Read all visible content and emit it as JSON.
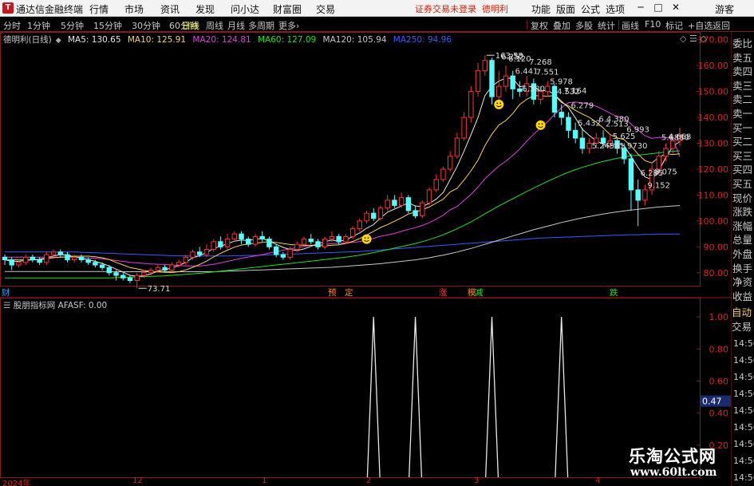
{
  "menubar": {
    "app_logo": "T",
    "app_title": "通达信金融终端",
    "items": [
      "行情",
      "市场",
      "资讯",
      "发现",
      "问小达",
      "财富圈",
      "交易"
    ],
    "trade_status": "证券交易未登录",
    "stock_name": "德明利",
    "right_items": [
      "功能",
      "版面",
      "公式",
      "选项"
    ],
    "user": "游客",
    "window_buttons": [
      "─",
      "□",
      "✕"
    ]
  },
  "periodbar": {
    "periods": [
      "分时",
      "1分钟",
      "5分钟",
      "15分钟",
      "30分钟",
      "60分钟",
      "日线",
      "周线",
      "月线",
      "多周期",
      "更多"
    ],
    "active_period": "日线",
    "more_arrow": "›",
    "tools": [
      "复权",
      "叠加",
      "多股",
      "统计",
      "画线",
      "F10",
      "标记",
      "+自选",
      "返回"
    ]
  },
  "chart_legend": {
    "title": "德明利(日线)",
    "collapse_icon": "◆",
    "ma": [
      {
        "label": "MA5: 130.65",
        "color": "#e8e8e8"
      },
      {
        "label": "MA10: 125.91",
        "color": "#ffd24a"
      },
      {
        "label": "MA20: 124.81",
        "color": "#e040e0"
      },
      {
        "label": "MA60: 127.09",
        "color": "#20e020"
      },
      {
        "label": "MA120: 105.94",
        "color": "#c8c8c8"
      },
      {
        "label": "MA250: 94.96",
        "color": "#3a5cff"
      }
    ],
    "controls": [
      "◇",
      "☰",
      "◇"
    ]
  },
  "price_axis": [
    "170.00",
    "160.00",
    "150.00",
    "140.00",
    "130.00",
    "120.00",
    "110.00",
    "100.00",
    "90.00",
    "80.00"
  ],
  "annotations": {
    "high": "163.58",
    "low": "73.71",
    "peak_labels": [
      "6.252",
      "6.120",
      "6.441",
      "6.380",
      "7.268",
      "7.551",
      "5.978",
      "4.532",
      "7.164",
      "6.279",
      "5.432",
      "5.2454",
      "6.4.380",
      "2.513",
      "5.625",
      "1.9730",
      "6.993",
      "6.285",
      "9.152",
      "8.075",
      "5.6880",
      "4.668"
    ]
  },
  "signals": [
    {
      "text": "财",
      "color": "#3aa0ff"
    },
    {
      "text": "预",
      "color": "#ff8c00"
    },
    {
      "text": "定",
      "color": "#ff8c00"
    },
    {
      "text": "涨",
      "color": "#ff3030"
    },
    {
      "text": "模",
      "color": "#ff8c00"
    },
    {
      "text": "减",
      "color": "#20e020"
    },
    {
      "text": "跌",
      "color": "#20e020"
    }
  ],
  "indicator": {
    "name": "股朋指标网",
    "formula": "AFASF: 0.00",
    "axis": [
      "1.00",
      "0.80",
      "0.60",
      "0.40",
      "0.20"
    ],
    "current_value": "0.47"
  },
  "quote_panel": {
    "labels": [
      "委比",
      "卖五",
      "卖四",
      "卖三",
      "卖二",
      "卖一",
      "买一",
      "买二",
      "买三",
      "买四",
      "买五",
      "现价",
      "涨跌",
      "涨幅",
      "总量",
      "外盘",
      "换手",
      "净资",
      "收益"
    ],
    "auto_trade": [
      "自动",
      "交易"
    ],
    "times": [
      "14:56",
      "14:56",
      "14:56",
      "14:56",
      "14:56",
      "14:56",
      "14:56",
      "14:56",
      "14:56",
      "14:56"
    ]
  },
  "date_axis": [
    "2024年",
    "12",
    "1",
    "2",
    "3",
    "4"
  ],
  "watermark": {
    "title": "乐淘公式网",
    "url": "www.60lt.com"
  },
  "colors": {
    "up": "#ff3232",
    "down": "#54ffff",
    "border": "#8b1a1a"
  },
  "chart_data": {
    "type": "candlestick",
    "ylim": [
      75,
      173
    ],
    "candles": [
      [
        86,
        85,
        87,
        83
      ],
      [
        85,
        83,
        86,
        81
      ],
      [
        83,
        84,
        85,
        82
      ],
      [
        84,
        86,
        87,
        83
      ],
      [
        86,
        85,
        87,
        84
      ],
      [
        85,
        84,
        86,
        83
      ],
      [
        84,
        87,
        88,
        83
      ],
      [
        87,
        88,
        89,
        86
      ],
      [
        88,
        87,
        89,
        86
      ],
      [
        87,
        85,
        88,
        84
      ],
      [
        85,
        86,
        87,
        84
      ],
      [
        86,
        85,
        87,
        84
      ],
      [
        85,
        84,
        86,
        83
      ],
      [
        84,
        83,
        85,
        82
      ],
      [
        83,
        82,
        84,
        81
      ],
      [
        82,
        80,
        83,
        79
      ],
      [
        80,
        79,
        81,
        77
      ],
      [
        79,
        78,
        80,
        77
      ],
      [
        78,
        77,
        79,
        76
      ],
      [
        77,
        79,
        80,
        74
      ],
      [
        79,
        80,
        81,
        78
      ],
      [
        80,
        81,
        82,
        79
      ],
      [
        81,
        82,
        83,
        80
      ],
      [
        82,
        81,
        83,
        80
      ],
      [
        81,
        83,
        84,
        80
      ],
      [
        83,
        84,
        85,
        82
      ],
      [
        84,
        86,
        87,
        83
      ],
      [
        86,
        88,
        89,
        85
      ],
      [
        88,
        87,
        90,
        86
      ],
      [
        87,
        89,
        91,
        86
      ],
      [
        89,
        92,
        93,
        88
      ],
      [
        92,
        90,
        94,
        89
      ],
      [
        90,
        93,
        95,
        89
      ],
      [
        93,
        95,
        96,
        92
      ],
      [
        95,
        93,
        96,
        91
      ],
      [
        93,
        91,
        94,
        90
      ],
      [
        91,
        94,
        95,
        90
      ],
      [
        94,
        93,
        96,
        92
      ],
      [
        93,
        90,
        94,
        89
      ],
      [
        90,
        87,
        91,
        86
      ],
      [
        87,
        86,
        88,
        85
      ],
      [
        86,
        89,
        90,
        85
      ],
      [
        89,
        91,
        92,
        88
      ],
      [
        91,
        93,
        94,
        90
      ],
      [
        93,
        92,
        95,
        91
      ],
      [
        92,
        90,
        93,
        89
      ],
      [
        90,
        93,
        94,
        89
      ],
      [
        93,
        94,
        96,
        92
      ],
      [
        94,
        92,
        95,
        91
      ],
      [
        92,
        94,
        95,
        91
      ],
      [
        94,
        97,
        98,
        93
      ],
      [
        97,
        100,
        101,
        96
      ],
      [
        100,
        103,
        104,
        99
      ],
      [
        103,
        101,
        105,
        100
      ],
      [
        101,
        105,
        106,
        100
      ],
      [
        105,
        108,
        110,
        104
      ],
      [
        108,
        106,
        110,
        105
      ],
      [
        106,
        109,
        111,
        105
      ],
      [
        109,
        104,
        110,
        103
      ],
      [
        104,
        102,
        106,
        101
      ],
      [
        102,
        107,
        108,
        101
      ],
      [
        107,
        112,
        113,
        106
      ],
      [
        112,
        116,
        118,
        111
      ],
      [
        116,
        120,
        121,
        115
      ],
      [
        120,
        125,
        127,
        119
      ],
      [
        125,
        132,
        134,
        124
      ],
      [
        132,
        140,
        142,
        131
      ],
      [
        140,
        150,
        152,
        138
      ],
      [
        150,
        158,
        161,
        148
      ],
      [
        158,
        162,
        164,
        156
      ],
      [
        162,
        148,
        163,
        145
      ],
      [
        148,
        152,
        158,
        145
      ],
      [
        152,
        156,
        160,
        150
      ],
      [
        156,
        151,
        158,
        147
      ],
      [
        151,
        150,
        154,
        148
      ],
      [
        150,
        153,
        156,
        148
      ],
      [
        153,
        147,
        155,
        145
      ],
      [
        147,
        150,
        152,
        145
      ],
      [
        150,
        152,
        154,
        148
      ],
      [
        152,
        142,
        153,
        140
      ],
      [
        142,
        140,
        145,
        137
      ],
      [
        140,
        135,
        142,
        132
      ],
      [
        135,
        132,
        138,
        130
      ],
      [
        132,
        128,
        136,
        126
      ],
      [
        128,
        130,
        132,
        126
      ],
      [
        130,
        132,
        134,
        128
      ],
      [
        132,
        130,
        135,
        128
      ],
      [
        130,
        131,
        133,
        128
      ],
      [
        131,
        128,
        132,
        126
      ],
      [
        128,
        124,
        130,
        122
      ],
      [
        124,
        112,
        126,
        104
      ],
      [
        112,
        108,
        116,
        98
      ],
      [
        108,
        112,
        114,
        106
      ],
      [
        112,
        120,
        122,
        110
      ],
      [
        120,
        125,
        127,
        118
      ],
      [
        125,
        128,
        130,
        123
      ],
      [
        128,
        131,
        133,
        126
      ],
      [
        131,
        133,
        136,
        129
      ]
    ],
    "ma5": [
      85,
      84.5,
      84.4,
      84.8,
      85,
      85.2,
      85.8,
      86.5,
      87,
      86.8,
      86.2,
      85.6,
      85,
      84.4,
      83.6,
      82.6,
      81.4,
      80.2,
      79,
      78.6,
      78.8,
      79.6,
      80.6,
      81.2,
      81.8,
      82.8,
      84,
      85.8,
      86.6,
      87.8,
      89.4,
      90.2,
      91.2,
      92.2,
      92.6,
      92.4,
      93,
      93.2,
      92.2,
      91,
      89.8,
      89,
      88.6,
      89.2,
      90.2,
      91.2,
      92,
      92.6,
      92.2,
      92.6,
      94,
      95.4,
      97.2,
      98.6,
      101.2,
      103.4,
      104.6,
      105.8,
      107,
      105.8,
      105.6,
      106.8,
      108.4,
      111,
      116,
      121,
      127,
      133.4,
      140,
      148.4,
      152,
      154,
      155.2,
      155,
      151.8,
      152.4,
      151.4,
      150.2,
      150.4,
      148.8,
      146.2,
      143.8,
      139.8,
      135.4,
      133,
      131,
      129.6,
      128.8,
      130.2,
      129,
      125,
      120.6,
      117,
      116,
      119.4,
      124.6,
      128.8,
      130.65
    ],
    "ma10": [
      85,
      85,
      85,
      85,
      85,
      85,
      85.4,
      85.8,
      86,
      86.2,
      86.4,
      86.4,
      86.4,
      86.2,
      85.8,
      85.1,
      84,
      83,
      82,
      81.5,
      80.9,
      80.5,
      80.3,
      80.2,
      80.1,
      80.4,
      81.1,
      82.1,
      83.2,
      84.5,
      86.1,
      87.5,
      88.7,
      89.9,
      90.7,
      91.1,
      91.4,
      91.7,
      92,
      91.7,
      91.3,
      90.9,
      90.7,
      90.6,
      90.6,
      90.5,
      90.4,
      90.6,
      90.8,
      91.3,
      92.1,
      93.2,
      94.6,
      96,
      97.5,
      98.6,
      99.9,
      101.2,
      102.7,
      103.4,
      104.4,
      105.4,
      106.9,
      108.4,
      111.2,
      112.6,
      115.8,
      119.4,
      123.5,
      129.1,
      133.5,
      137,
      138.8,
      141.5,
      145,
      147,
      148.3,
      148.4,
      148.1,
      148.5,
      145.8,
      144.4,
      142.7,
      141.3,
      140,
      138.2,
      135.9,
      133.3,
      132.1,
      131.4,
      129,
      125.8,
      123.3,
      122.4,
      124.6,
      125.9,
      125.7,
      125.91
    ],
    "ma20": [
      86,
      86,
      86,
      86,
      86,
      86,
      86,
      86,
      86,
      86,
      86,
      85.9,
      85.7,
      85.6,
      85.4,
      85.1,
      84.7,
      84.4,
      84,
      83.8,
      83.6,
      83.4,
      83.3,
      83.2,
      83,
      82.8,
      82.6,
      82.6,
      82.6,
      82.9,
      83.3,
      83.8,
      84.4,
      85,
      85.6,
      86.1,
      86.5,
      87,
      87.6,
      88.1,
      88.7,
      89.2,
      89.7,
      90.2,
      90.6,
      90.8,
      90.9,
      91.2,
      91.4,
      91.5,
      91.7,
      92,
      92.6,
      93.3,
      94.1,
      94.6,
      95.2,
      96,
      96.8,
      97.4,
      98.3,
      99.3,
      100.7,
      102.2,
      104.3,
      105.6,
      107.9,
      110.3,
      113.1,
      116.3,
      118.8,
      121.2,
      123.1,
      125.3,
      127.8,
      130.8,
      133.5,
      136,
      138.3,
      141.1,
      143.7,
      145.7,
      145.9,
      145.6,
      145.1,
      144.3,
      143,
      141.6,
      140.4,
      139.9,
      137.4,
      135.1,
      132.9,
      131.9,
      132.3,
      132.2,
      131.8,
      124.81
    ],
    "ma60": [
      78,
      78,
      78,
      78,
      78,
      78,
      78,
      78,
      78,
      78,
      78,
      78,
      78,
      78,
      78,
      78,
      78.1,
      78.2,
      78.3,
      78.4,
      78.5,
      78.6,
      78.7,
      78.8,
      79,
      79.2,
      79.4,
      79.6,
      79.8,
      80,
      80.3,
      80.6,
      80.9,
      81.2,
      81.5,
      81.8,
      82.1,
      82.4,
      82.7,
      83,
      83.3,
      83.6,
      83.9,
      84.2,
      84.5,
      84.8,
      85.1,
      85.4,
      85.7,
      86,
      86.4,
      86.8,
      87.3,
      87.8,
      88.3,
      88.9,
      89.5,
      90.1,
      90.7,
      91.3,
      92,
      92.8,
      93.7,
      94.7,
      95.8,
      97,
      98.3,
      99.7,
      101.2,
      102.8,
      104.3,
      105.8,
      107.2,
      108.6,
      110,
      111.4,
      112.7,
      114,
      115.3,
      116.5,
      117.7,
      118.8,
      119.8,
      120.7,
      121.5,
      122.3,
      123,
      123.6,
      124.2,
      124.7,
      125.1,
      125.4,
      125.7,
      126,
      126.3,
      126.6,
      126.9,
      127.09
    ],
    "ma120": [
      80.5,
      80.5,
      80.5,
      80.5,
      80.5,
      80.5,
      80.5,
      80.5,
      80.5,
      80.5,
      80.5,
      80.5,
      80.5,
      80.5,
      80.5,
      80.5,
      80.4,
      80.4,
      80.4,
      80.4,
      80.4,
      80.4,
      80.4,
      80.4,
      80.4,
      80.4,
      80.4,
      80.4,
      80.4,
      80.4,
      80.4,
      80.5,
      80.6,
      80.7,
      80.8,
      80.9,
      81,
      81.1,
      81.2,
      81.3,
      81.4,
      81.5,
      81.6,
      81.7,
      81.8,
      81.9,
      82,
      82.1,
      82.3,
      82.5,
      82.7,
      82.9,
      83.1,
      83.3,
      83.5,
      83.8,
      84.1,
      84.4,
      84.7,
      85,
      85.4,
      85.8,
      86.3,
      86.8,
      87.4,
      88,
      88.7,
      89.4,
      90.2,
      91,
      91.8,
      92.6,
      93.4,
      94.2,
      95,
      95.8,
      96.6,
      97.3,
      98,
      98.7,
      99.4,
      100,
      100.6,
      101.2,
      101.7,
      102.2,
      102.7,
      103.1,
      103.5,
      103.9,
      104.2,
      104.5,
      104.8,
      105.1,
      105.4,
      105.6,
      105.8,
      105.94
    ],
    "ma250": [
      88,
      88,
      88,
      88,
      88,
      88,
      88,
      88,
      88,
      88,
      88,
      87.9,
      87.8,
      87.7,
      87.6,
      87.5,
      87.4,
      87.3,
      87.2,
      87.1,
      87,
      86.9,
      86.8,
      86.7,
      86.6,
      86.6,
      86.5,
      86.5,
      86.5,
      86.5,
      86.5,
      86.5,
      86.5,
      86.6,
      86.6,
      86.7,
      86.7,
      86.8,
      86.9,
      87,
      87.1,
      87.2,
      87.3,
      87.4,
      87.5,
      87.6,
      87.7,
      87.8,
      87.9,
      88,
      88.1,
      88.2,
      88.4,
      88.6,
      88.8,
      89,
      89.2,
      89.4,
      89.6,
      89.8,
      90,
      90.2,
      90.4,
      90.6,
      90.8,
      91,
      91.2,
      91.4,
      91.6,
      91.8,
      92,
      92.2,
      92.4,
      92.6,
      92.8,
      93,
      93.2,
      93.4,
      93.5,
      93.6,
      93.7,
      93.8,
      93.9,
      94,
      94.1,
      94.2,
      94.3,
      94.4,
      94.5,
      94.6,
      94.7,
      94.7,
      94.8,
      94.8,
      94.9,
      94.9,
      94.95,
      94.96
    ],
    "indicator_series": {
      "name": "AFASF",
      "ylim": [
        0,
        1.1
      ],
      "spikes_at_index": [
        53,
        59,
        70,
        80
      ],
      "spike_value": 1.0
    }
  }
}
